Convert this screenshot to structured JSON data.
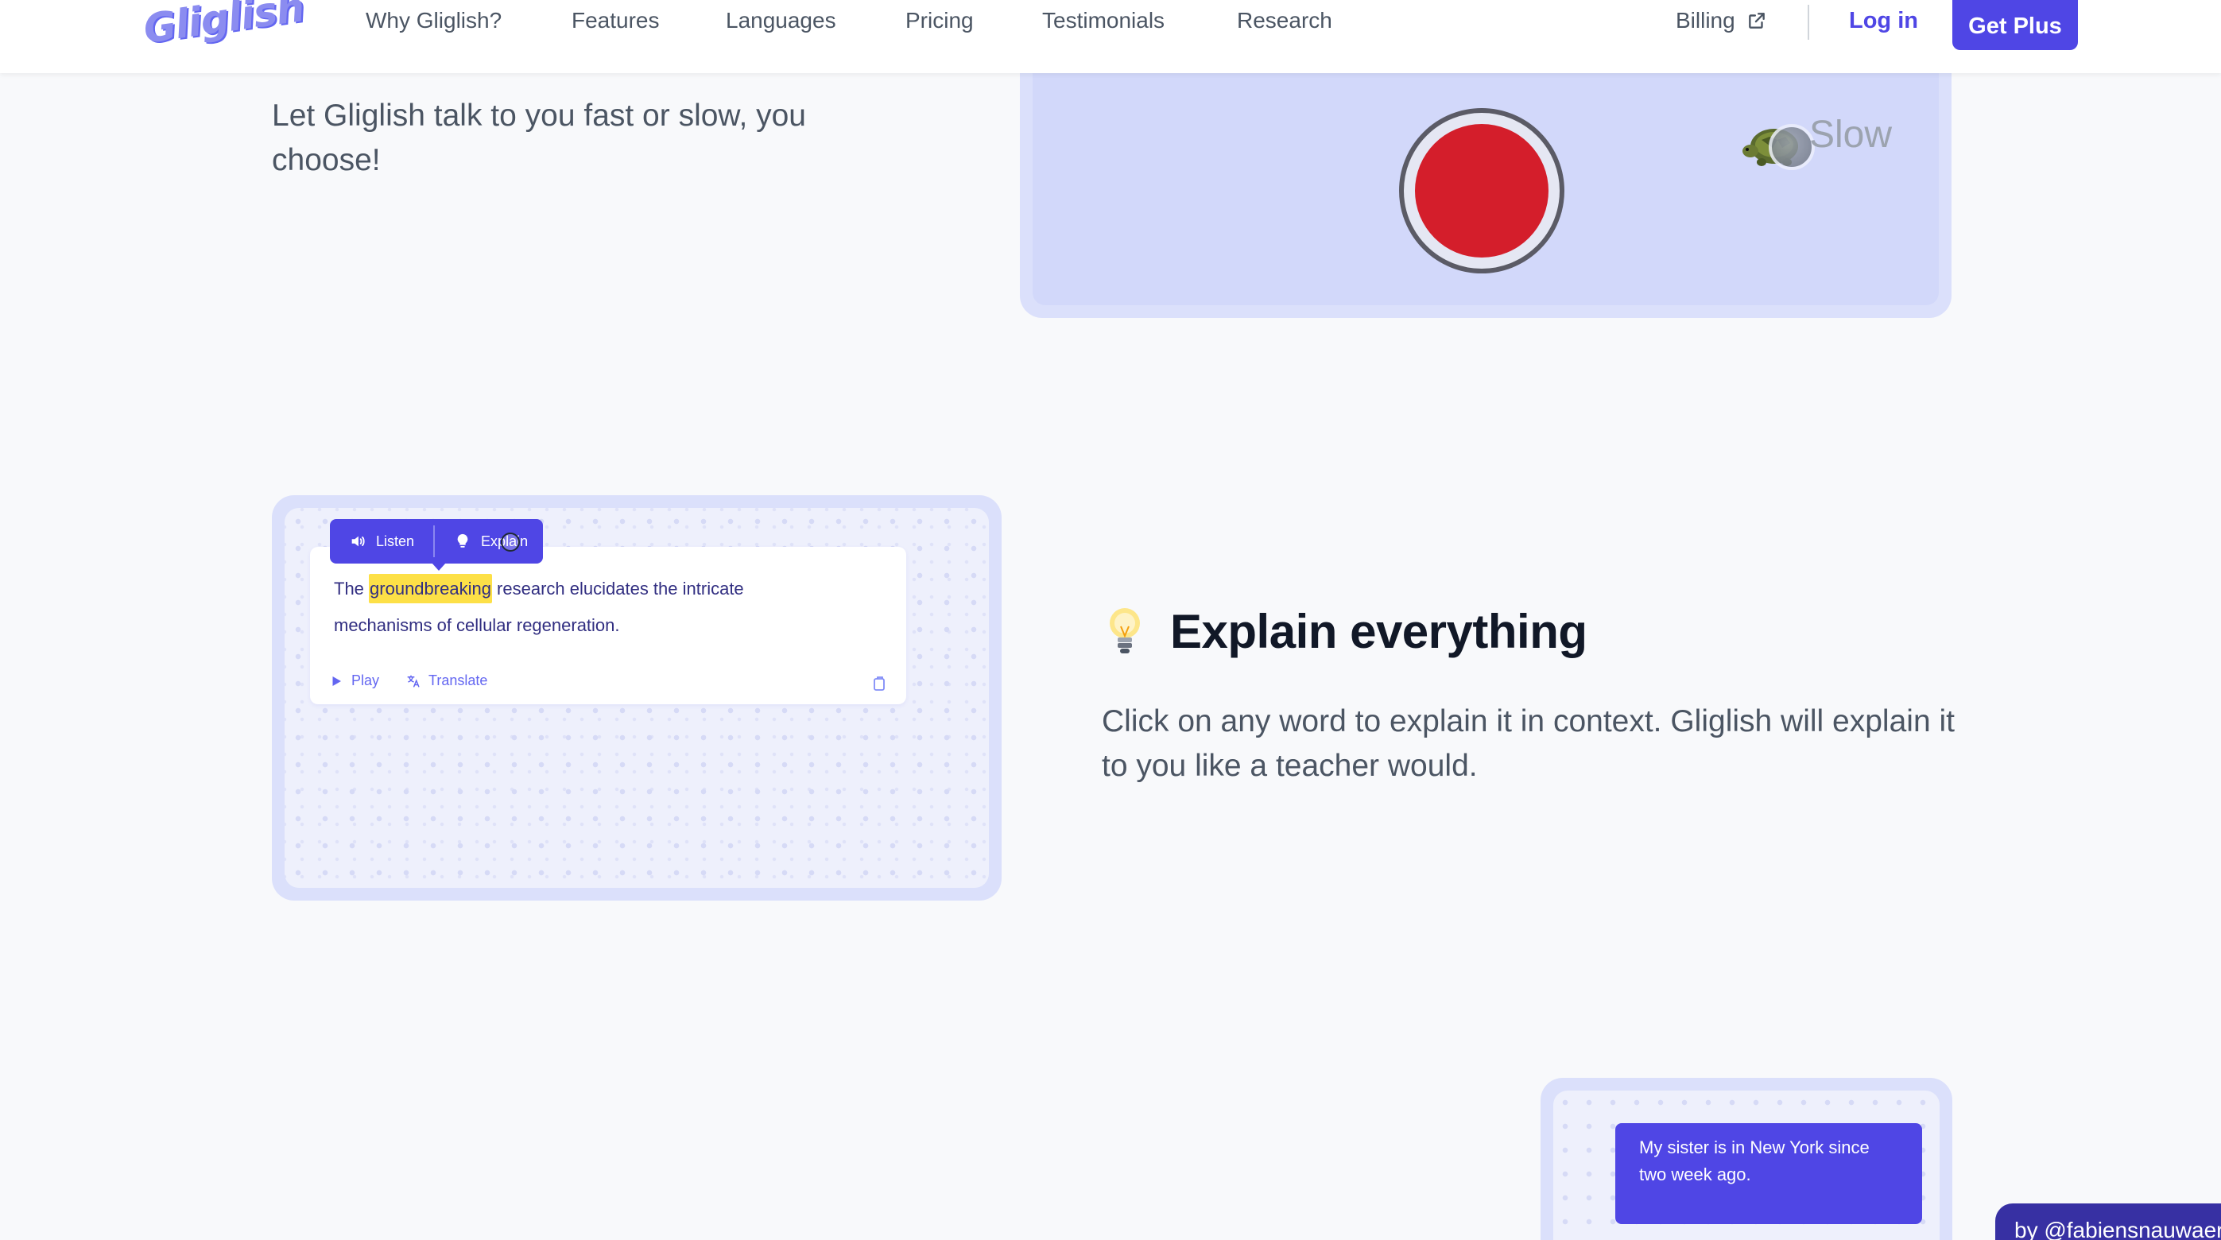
{
  "brand": {
    "logo_text": "Gliglish",
    "accent": "#4f46e5"
  },
  "nav": {
    "links": [
      "Why Gliglish?",
      "Features",
      "Languages",
      "Pricing",
      "Testimonials",
      "Research"
    ],
    "billing_label": "Billing",
    "login_label": "Log in",
    "cta_label": "Get Plus"
  },
  "speed_section": {
    "description": "Let Gliglish talk to you fast or slow, you choose!",
    "slider_label": "Slow",
    "record_color": "#d41e2b"
  },
  "explain_section": {
    "popup": {
      "listen_label": "Listen",
      "explain_label": "Explain"
    },
    "sentence_before": "The ",
    "sentence_highlight": "groundbreaking",
    "sentence_after": " research elucidates the intricate mechanisms of cellular regeneration.",
    "actions": {
      "play_label": "Play",
      "translate_label": "Translate"
    },
    "title": "Explain everything",
    "description": "Click on any word to explain it in context. Gliglish will explain it to you like a teacher would."
  },
  "correction_section": {
    "chat_message": "My sister is in New York since two week ago."
  },
  "credit": {
    "text": "by @fabiensnauwaert"
  }
}
